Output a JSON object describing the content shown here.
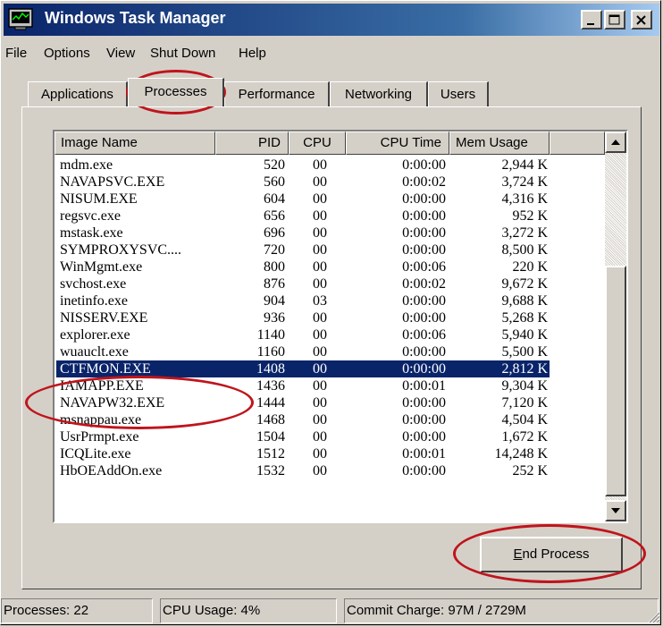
{
  "window": {
    "title": "Windows Task Manager",
    "app_icon": "task-manager-icon"
  },
  "title_buttons": [
    {
      "name": "minimize-icon"
    },
    {
      "name": "maximize-icon"
    },
    {
      "name": "close-icon"
    }
  ],
  "menu": [
    "File",
    "Options",
    "View",
    "Shut Down",
    "Help"
  ],
  "tabs": [
    "Applications",
    "Processes",
    "Performance",
    "Networking",
    "Users"
  ],
  "active_tab": "Processes",
  "columns": [
    "Image Name",
    "PID",
    "CPU",
    "CPU Time",
    "Mem Usage"
  ],
  "processes": [
    {
      "name": "mdm.exe",
      "pid": "520",
      "cpu": "00",
      "time": "0:00:00",
      "mem": "2,944 K"
    },
    {
      "name": "NAVAPSVC.EXE",
      "pid": "560",
      "cpu": "00",
      "time": "0:00:02",
      "mem": "3,724 K"
    },
    {
      "name": "NISUM.EXE",
      "pid": "604",
      "cpu": "00",
      "time": "0:00:00",
      "mem": "4,316 K"
    },
    {
      "name": "regsvc.exe",
      "pid": "656",
      "cpu": "00",
      "time": "0:00:00",
      "mem": "952 K"
    },
    {
      "name": "mstask.exe",
      "pid": "696",
      "cpu": "00",
      "time": "0:00:00",
      "mem": "3,272 K"
    },
    {
      "name": "SYMPROXYSVC....",
      "pid": "720",
      "cpu": "00",
      "time": "0:00:00",
      "mem": "8,500 K"
    },
    {
      "name": "WinMgmt.exe",
      "pid": "800",
      "cpu": "00",
      "time": "0:00:06",
      "mem": "220 K"
    },
    {
      "name": "svchost.exe",
      "pid": "876",
      "cpu": "00",
      "time": "0:00:02",
      "mem": "9,672 K"
    },
    {
      "name": "inetinfo.exe",
      "pid": "904",
      "cpu": "03",
      "time": "0:00:00",
      "mem": "9,688 K"
    },
    {
      "name": "NISSERV.EXE",
      "pid": "936",
      "cpu": "00",
      "time": "0:00:00",
      "mem": "5,268 K"
    },
    {
      "name": "explorer.exe",
      "pid": "1140",
      "cpu": "00",
      "time": "0:00:06",
      "mem": "5,940 K"
    },
    {
      "name": "wuauclt.exe",
      "pid": "1160",
      "cpu": "00",
      "time": "0:00:00",
      "mem": "5,500 K"
    },
    {
      "name": "CTFMON.EXE",
      "pid": "1408",
      "cpu": "00",
      "time": "0:00:00",
      "mem": "2,812 K",
      "selected": true
    },
    {
      "name": "IAMAPP.EXE",
      "pid": "1436",
      "cpu": "00",
      "time": "0:00:01",
      "mem": "9,304 K"
    },
    {
      "name": "NAVAPW32.EXE",
      "pid": "1444",
      "cpu": "00",
      "time": "0:00:00",
      "mem": "7,120 K"
    },
    {
      "name": "msnappau.exe",
      "pid": "1468",
      "cpu": "00",
      "time": "0:00:00",
      "mem": "4,504 K"
    },
    {
      "name": "UsrPrmpt.exe",
      "pid": "1504",
      "cpu": "00",
      "time": "0:00:00",
      "mem": "1,672 K"
    },
    {
      "name": "ICQLite.exe",
      "pid": "1512",
      "cpu": "00",
      "time": "0:00:01",
      "mem": "14,248 K"
    },
    {
      "name": "HbOEAddOn.exe",
      "pid": "1532",
      "cpu": "00",
      "time": "0:00:00",
      "mem": "252 K"
    }
  ],
  "end_process": {
    "underlined": "E",
    "rest": "nd Process"
  },
  "status": {
    "processes": "Processes: 22",
    "cpu_usage": "CPU Usage: 4%",
    "commit": "Commit Charge: 97M / 2729M"
  },
  "annotation_color": "#c0141c"
}
